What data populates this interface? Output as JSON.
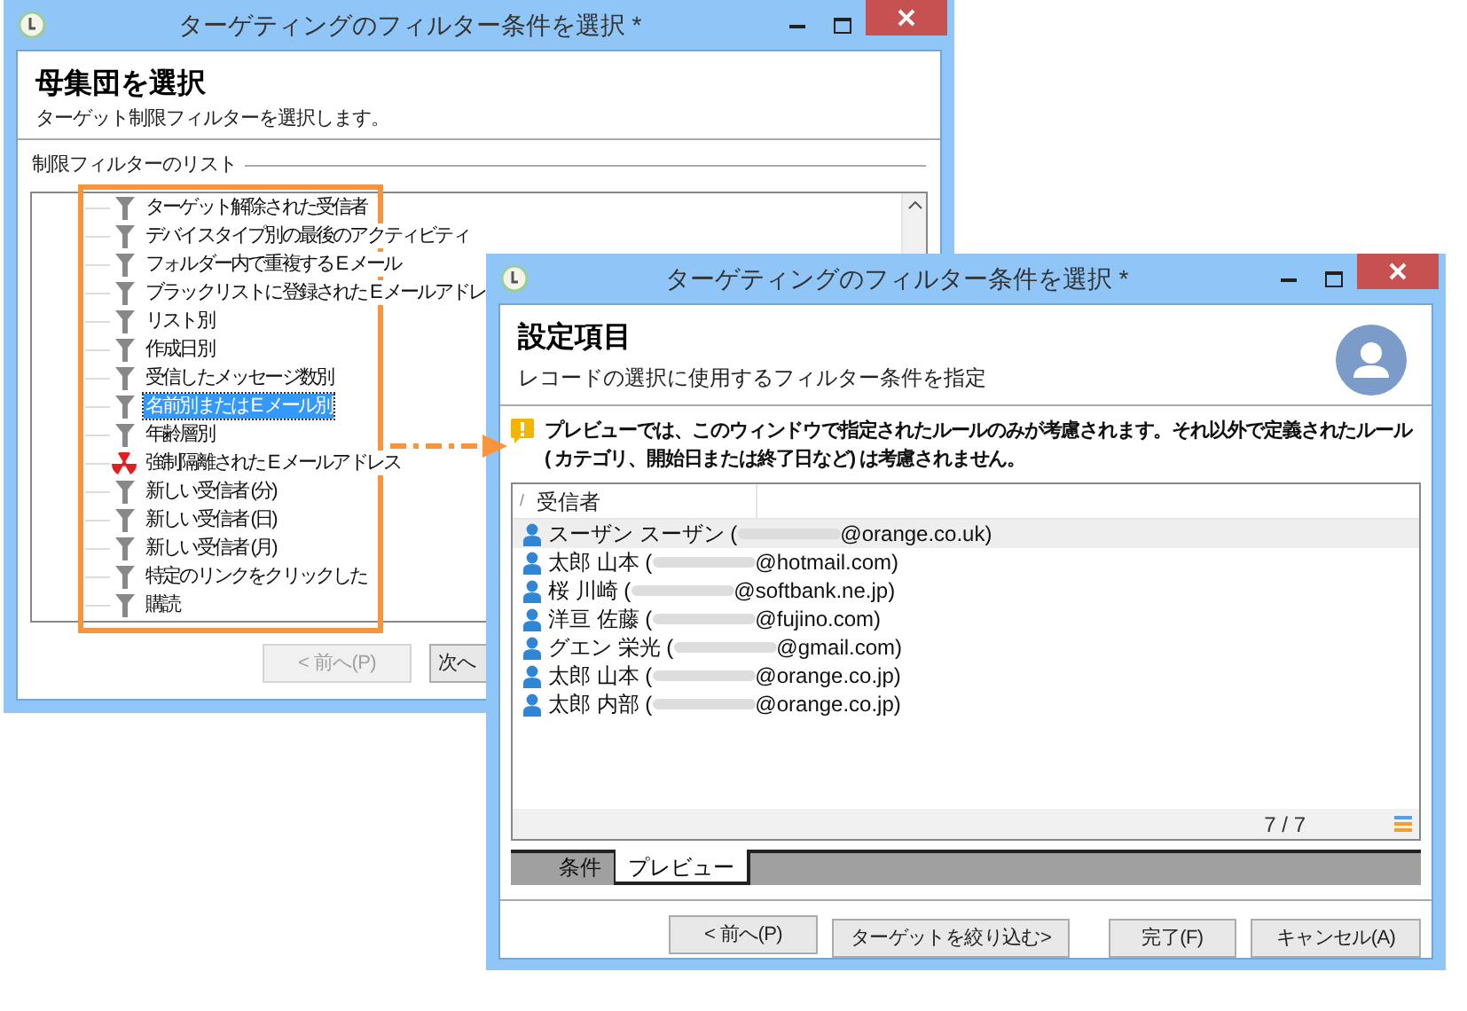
{
  "back_window": {
    "title": "ターゲティングのフィルター条件を選択 *",
    "heading": "母集団を選択",
    "subtitle": "ターゲット制限フィルターを選択します。",
    "group_label": "制限フィルターのリスト",
    "filters": [
      {
        "label": "ターゲット解除された受信者",
        "kind": "filter",
        "selected": false
      },
      {
        "label": "デバイスタイプ別の最後のアクティビティ",
        "kind": "filter",
        "selected": false
      },
      {
        "label": "フォルダー内で重複する E メール",
        "kind": "filter",
        "selected": false
      },
      {
        "label": "ブラックリストに登録された E メールアドレ",
        "kind": "filter",
        "selected": false
      },
      {
        "label": "リスト別",
        "kind": "filter",
        "selected": false
      },
      {
        "label": "作成日別",
        "kind": "filter",
        "selected": false
      },
      {
        "label": "受信したメッセージ数別",
        "kind": "filter",
        "selected": false
      },
      {
        "label": "名前別または E メール別",
        "kind": "filter",
        "selected": true
      },
      {
        "label": "年齢層別",
        "kind": "filter",
        "selected": false
      },
      {
        "label": "強制隔離された E メールアドレス",
        "kind": "quarantine",
        "selected": false
      },
      {
        "label": "新しい受信者 (分)",
        "kind": "filter",
        "selected": false
      },
      {
        "label": "新しい受信者 (日)",
        "kind": "filter",
        "selected": false
      },
      {
        "label": "新しい受信者 (月)",
        "kind": "filter",
        "selected": false
      },
      {
        "label": "特定のリンクをクリックした",
        "kind": "filter",
        "selected": false
      },
      {
        "label": "購読",
        "kind": "filter",
        "selected": false
      }
    ],
    "buttons": [
      {
        "label": "< 前へ(P)",
        "disabled": true
      },
      {
        "label": "次へ",
        "disabled": false
      }
    ]
  },
  "front_window": {
    "title": "ターゲティングのフィルター条件を選択 *",
    "heading": "設定項目",
    "subtitle": "レコードの選択に使用するフィルター条件を指定",
    "warning": "プレビューでは、このウィンドウで指定されたルールのみが考慮されます。それ以外で定義されたルール ( カテゴリ、開始日または終了日など) は考慮されません。",
    "table": {
      "sort_mark": "/",
      "column": "受信者",
      "rows": [
        {
          "name": "スーザン スーザン (",
          "domain": "@orange.co.uk)",
          "selected": true
        },
        {
          "name": "太郎 山本 (",
          "domain": "@hotmail.com)",
          "selected": false
        },
        {
          "name": "桜 川崎 (",
          "domain": "@softbank.ne.jp)",
          "selected": false
        },
        {
          "name": "洋亘 佐藤 (",
          "domain": "@fujino.com)",
          "selected": false
        },
        {
          "name": "グエン 栄光 (",
          "domain": "@gmail.com)",
          "selected": false
        },
        {
          "name": "太郎 山本 (",
          "domain": "@orange.co.jp)",
          "selected": false
        },
        {
          "name": "太郎 内部 (",
          "domain": "@orange.co.jp)",
          "selected": false
        }
      ],
      "count": "7 / 7"
    },
    "tabs": [
      {
        "label": "条件",
        "selected": false
      },
      {
        "label": "プレビュー",
        "selected": true
      }
    ],
    "buttons": [
      {
        "label": "< 前へ(P)",
        "disabled": false
      },
      {
        "label": "ターゲットを絞り込む>",
        "disabled": false
      },
      {
        "label": "完了(F)",
        "disabled": false
      },
      {
        "label": "キャンセル(A)",
        "disabled": false
      }
    ]
  }
}
